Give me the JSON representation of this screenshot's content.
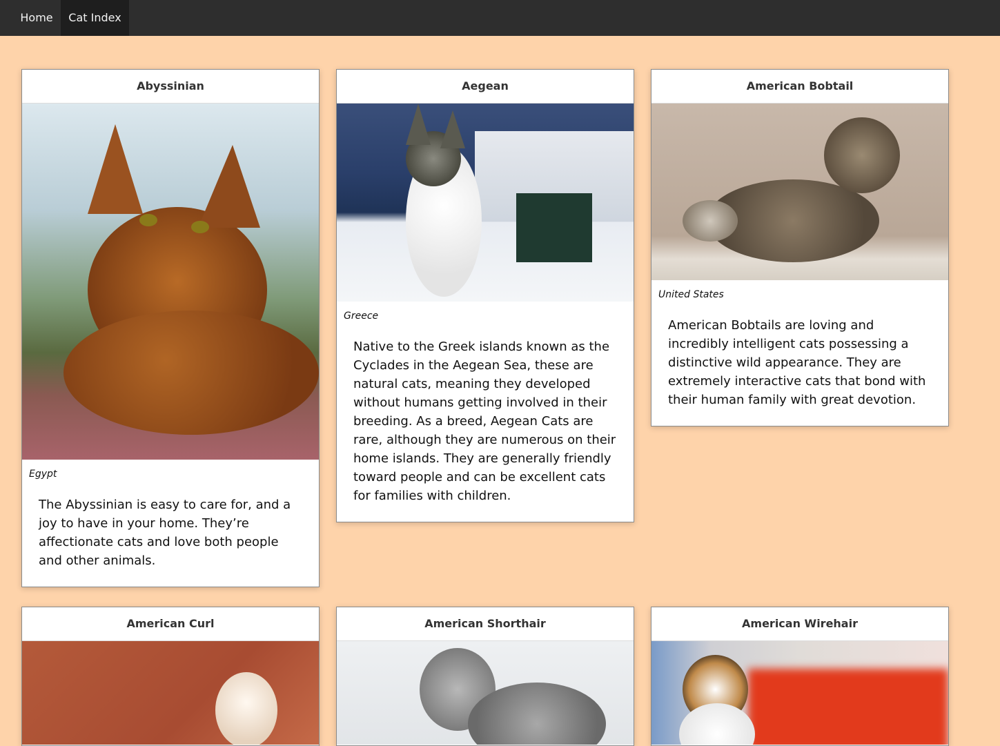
{
  "nav": {
    "home_label": "Home",
    "index_label": "Cat Index"
  },
  "cats": [
    {
      "name": "Abyssinian",
      "origin": "Egypt",
      "description": "The Abyssinian is easy to care for, and a joy to have in your home. They’re affectionate cats and love both people and other animals."
    },
    {
      "name": "Aegean",
      "origin": "Greece",
      "description": "Native to the Greek islands known as the Cyclades in the Aegean Sea, these are natural cats, meaning they developed without humans getting involved in their breeding. As a breed, Aegean Cats are rare, although they are numerous on their home islands. They are generally friendly toward people and can be excellent cats for families with children."
    },
    {
      "name": "American Bobtail",
      "origin": "United States",
      "description": "American Bobtails are loving and incredibly intelligent cats possessing a distinctive wild appearance. They are extremely interactive cats that bond with their human family with great devotion."
    },
    {
      "name": "American Curl"
    },
    {
      "name": "American Shorthair"
    },
    {
      "name": "American Wirehair"
    }
  ]
}
